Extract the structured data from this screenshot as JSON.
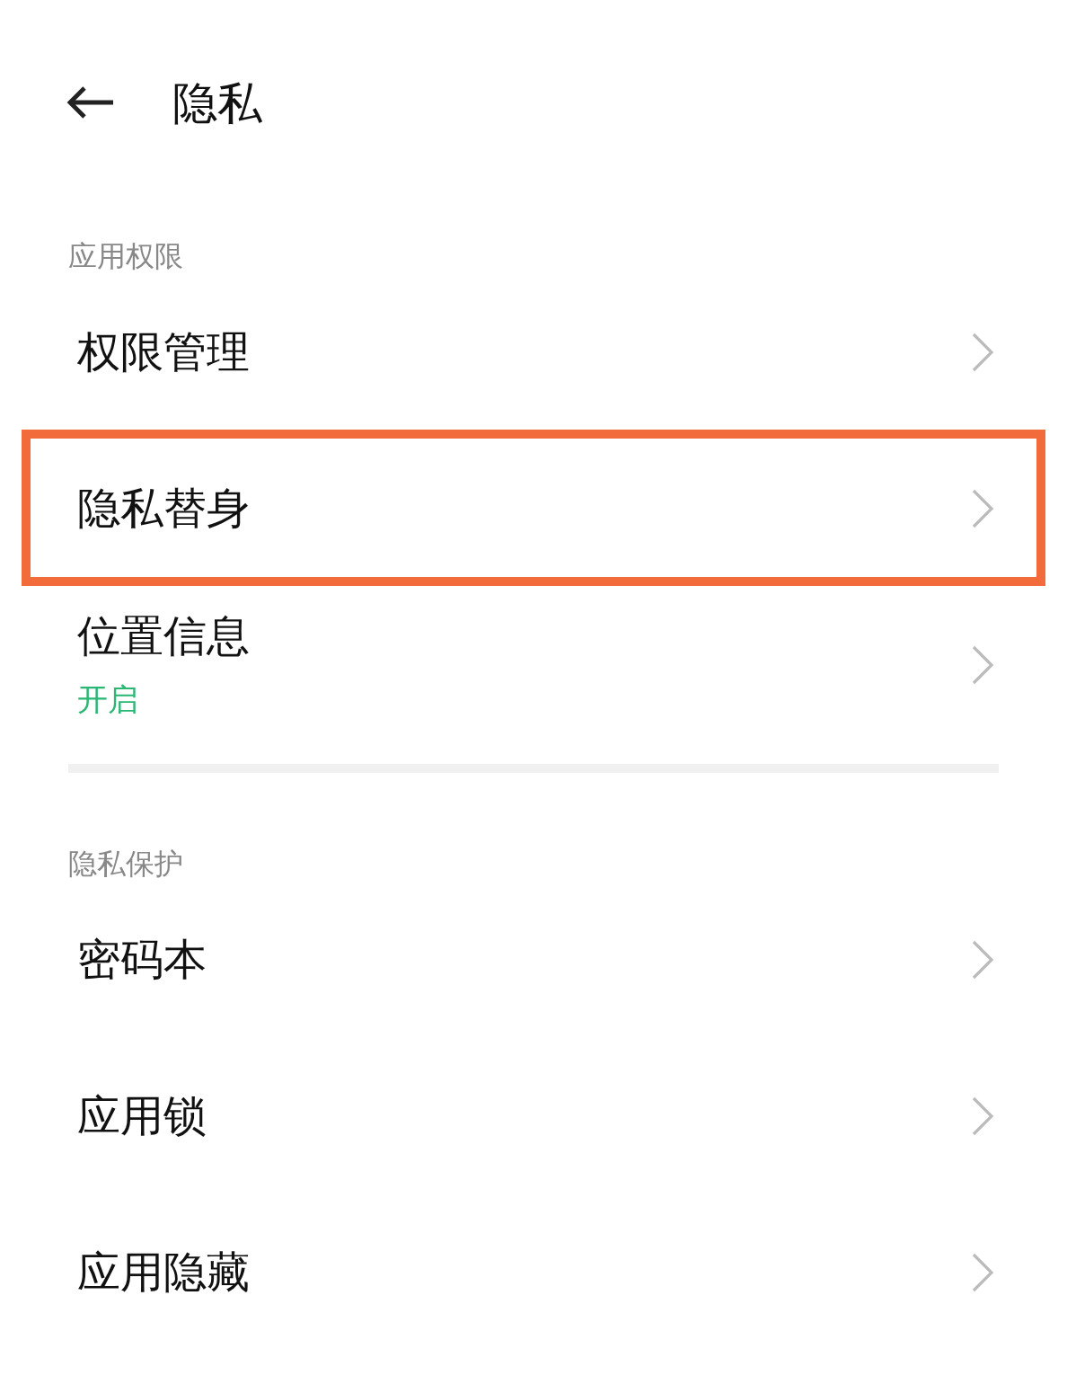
{
  "header": {
    "title": "隐私"
  },
  "sections": [
    {
      "title": "应用权限",
      "items": [
        {
          "label": "权限管理",
          "highlighted": false
        },
        {
          "label": "隐私替身",
          "highlighted": true
        },
        {
          "label": "位置信息",
          "status": "开启",
          "highlighted": false
        }
      ]
    },
    {
      "title": "隐私保护",
      "items": [
        {
          "label": "密码本",
          "highlighted": false
        },
        {
          "label": "应用锁",
          "highlighted": false
        },
        {
          "label": "应用隐藏",
          "highlighted": false
        }
      ]
    }
  ]
}
